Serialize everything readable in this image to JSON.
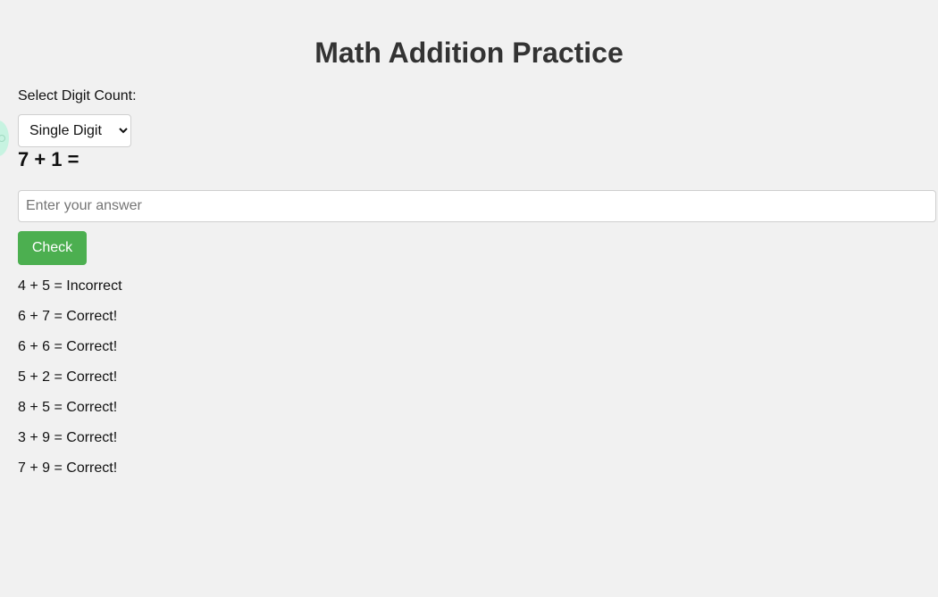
{
  "app": {
    "title": "Math Addition Practice"
  },
  "digit_select": {
    "label": "Select Digit Count:",
    "selected": "Single Digit"
  },
  "question": {
    "text": "7 + 1 ="
  },
  "answer": {
    "value": "",
    "placeholder": "Enter your answer"
  },
  "check_button": {
    "label": "Check"
  },
  "history": [
    {
      "text": "4 + 5 = Incorrect"
    },
    {
      "text": "6 + 7 = Correct!"
    },
    {
      "text": "6 + 6 = Correct!"
    },
    {
      "text": "5 + 2 = Correct!"
    },
    {
      "text": "8 + 5 = Correct!"
    },
    {
      "text": "3 + 9 = Correct!"
    },
    {
      "text": "7 + 9 = Correct!"
    }
  ],
  "colors": {
    "background": "#f1f1f1",
    "title": "#333333",
    "button": "#4caf50",
    "button_text": "#ffffff"
  }
}
